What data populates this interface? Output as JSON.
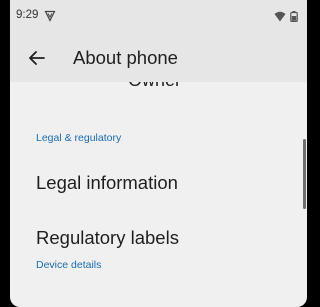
{
  "status_bar": {
    "time": "9:29",
    "left_icons": [
      "notification-shield-icon"
    ],
    "right_icons": [
      "wifi-icon",
      "battery-icon"
    ]
  },
  "app_bar": {
    "back_icon": "back-arrow-icon",
    "title": "About phone"
  },
  "list": {
    "clipped_item": "Owner",
    "sections": [
      {
        "header": "Legal & regulatory",
        "items": [
          "Legal information",
          "Regulatory labels"
        ]
      },
      {
        "header": "Device details",
        "items": []
      }
    ]
  },
  "colors": {
    "background": "#f0f0f0",
    "app_bar": "#e6e6e6",
    "section_header": "#1a6cb3",
    "text_primary": "#1f1f1f"
  }
}
